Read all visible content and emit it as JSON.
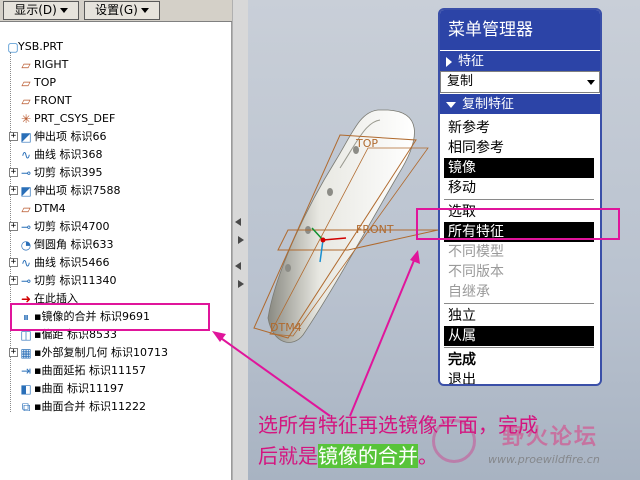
{
  "toolbar": {
    "display_label": "显示(D)",
    "settings_label": "设置(G)"
  },
  "tree": {
    "root": "YSB.PRT",
    "items": [
      {
        "label": "RIGHT",
        "icon": "datum-plane-icon",
        "expandable": false
      },
      {
        "label": "TOP",
        "icon": "datum-plane-icon",
        "expandable": false
      },
      {
        "label": "FRONT",
        "icon": "datum-plane-icon",
        "expandable": false
      },
      {
        "label": "PRT_CSYS_DEF",
        "icon": "csys-icon",
        "expandable": false
      },
      {
        "label": "伸出项 标识66",
        "icon": "extrude-icon",
        "expandable": true
      },
      {
        "label": "曲线 标识368",
        "icon": "curve-icon",
        "expandable": false
      },
      {
        "label": "切剪 标识395",
        "icon": "cut-icon",
        "expandable": true
      },
      {
        "label": "伸出项 标识7588",
        "icon": "extrude-icon",
        "expandable": true
      },
      {
        "label": "DTM4",
        "icon": "datum-plane-icon",
        "expandable": false
      },
      {
        "label": "切剪 标识4700",
        "icon": "cut-icon",
        "expandable": true
      },
      {
        "label": "倒圆角 标识633",
        "icon": "round-icon",
        "expandable": false
      },
      {
        "label": "曲线 标识5466",
        "icon": "curve-icon",
        "expandable": true
      },
      {
        "label": "切剪 标识11340",
        "icon": "cut-icon",
        "expandable": true
      },
      {
        "label": "在此插入",
        "icon": "insert-here-icon",
        "expandable": false
      },
      {
        "label": "▪镜像的合并 标识9691",
        "icon": "mirror-merge-icon",
        "expandable": false
      },
      {
        "label": "▪偏距 标识8533",
        "icon": "offset-icon",
        "expandable": false
      },
      {
        "label": "▪外部复制几何 标识10713",
        "icon": "copy-geom-icon",
        "expandable": true
      },
      {
        "label": "▪曲面延拓 标识11157",
        "icon": "extend-icon",
        "expandable": false
      },
      {
        "label": "▪曲面 标识11197",
        "icon": "surface-icon",
        "expandable": false
      },
      {
        "label": "▪曲面合并 标识11222",
        "icon": "merge-icon",
        "expandable": false
      }
    ]
  },
  "model": {
    "datum_top": "TOP",
    "datum_front": "FRONT",
    "datum_dtm4": "DTM4"
  },
  "menu": {
    "title": "菜单管理器",
    "section1": "特征",
    "select_value": "复制",
    "section2": "复制特征",
    "items": [
      {
        "label": "新参考",
        "state": "normal"
      },
      {
        "label": "相同参考",
        "state": "normal"
      },
      {
        "label": "镜像",
        "state": "selected"
      },
      {
        "label": "移动",
        "state": "normal"
      },
      {
        "label": "sep"
      },
      {
        "label": "选取",
        "state": "normal"
      },
      {
        "label": "所有特征",
        "state": "selected"
      },
      {
        "label": "不同模型",
        "state": "disabled"
      },
      {
        "label": "不同版本",
        "state": "disabled"
      },
      {
        "label": "自继承",
        "state": "disabled"
      },
      {
        "label": "sep"
      },
      {
        "label": "独立",
        "state": "normal"
      },
      {
        "label": "从属",
        "state": "selected"
      },
      {
        "label": "sep"
      },
      {
        "label": "完成",
        "state": "bold"
      },
      {
        "label": "退出",
        "state": "normal"
      }
    ]
  },
  "annotation": {
    "line1": "选所有特征再选镜像平面，完成",
    "line2_prefix": "后就是",
    "line2_highlight": "镜像的合并",
    "line2_suffix": "。"
  },
  "watermark": {
    "text": "野火论坛",
    "url": "www.proewildfire.cn"
  },
  "colors": {
    "menu_blue": "#2c44a7",
    "highlight_magenta": "#e0159b",
    "annotation_text": "#d4147f",
    "annotation_highlight": "#58c43a"
  }
}
